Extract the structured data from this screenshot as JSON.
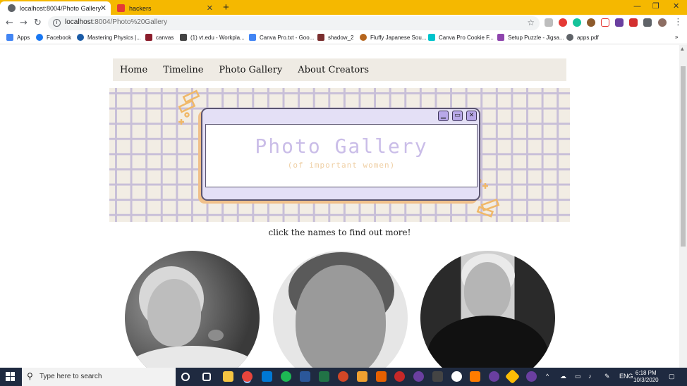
{
  "browser": {
    "tabs": [
      {
        "title": "localhost:8004/Photo Gallery",
        "active": true
      },
      {
        "title": "hackers",
        "active": false
      }
    ],
    "new_tab": "+",
    "window_controls": {
      "minimize": "—",
      "restore": "❐",
      "close": "✕"
    },
    "url": {
      "host": "localhost",
      "path": ":8004/Photo%20Gallery"
    },
    "bookmarks": [
      {
        "label": "Apps",
        "icon": "apps-grid-icon",
        "color": "#4285f4"
      },
      {
        "label": "Facebook",
        "icon": "facebook-icon",
        "color": "#1877f2"
      },
      {
        "label": "Mastering Physics |...",
        "icon": "pearson-icon",
        "color": "#1a5ba6"
      },
      {
        "label": "canvas",
        "icon": "canvas-icon",
        "color": "#8b1d2c"
      },
      {
        "label": "(1) vt.edu - Workpla...",
        "icon": "workplace-icon",
        "color": "#444444"
      },
      {
        "label": "Canva Pro.txt - Goo...",
        "icon": "google-docs-icon",
        "color": "#4285f4"
      },
      {
        "label": "shadow_2",
        "icon": "shadow-icon",
        "color": "#7a2f2f"
      },
      {
        "label": "Fluffy Japanese Sou...",
        "icon": "recipe-icon",
        "color": "#b5651d"
      },
      {
        "label": "Canva Pro Cookie F...",
        "icon": "canva-icon",
        "color": "#00c4cc"
      },
      {
        "label": "Setup Puzzle - Jigsa...",
        "icon": "puzzle-icon",
        "color": "#8e44ad"
      },
      {
        "label": "apps.pdf",
        "icon": "globe-icon",
        "color": "#5f6368"
      }
    ],
    "bookmarks_overflow": "»"
  },
  "site": {
    "nav": [
      "Home",
      "Timeline",
      "Photo Gallery",
      "About Creators"
    ],
    "banner": {
      "title": "Photo Gallery",
      "subtitle": "(of important women)",
      "buttons": {
        "minimize": "▁",
        "maximize": "▭",
        "close": "✕"
      }
    },
    "caption": "click the names to find out more!",
    "photos": [
      "portrait-1",
      "portrait-2",
      "portrait-3"
    ]
  },
  "taskbar": {
    "search_placeholder": "Type here to search",
    "language": "ENG",
    "time": "6:18 PM",
    "date": "10/3/2020"
  }
}
